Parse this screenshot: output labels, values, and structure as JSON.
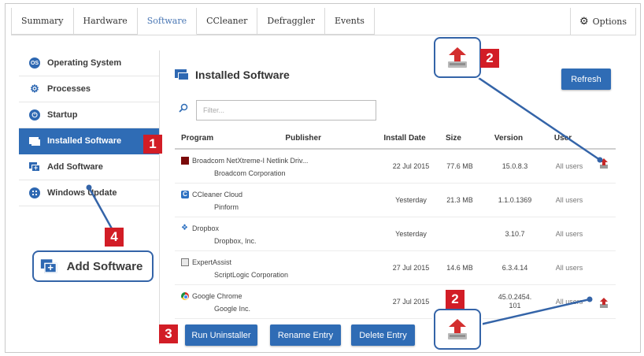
{
  "tabs": [
    "Summary",
    "Hardware",
    "Software",
    "CCleaner",
    "Defraggler",
    "Events"
  ],
  "active_tab": "Software",
  "options_label": "Options",
  "sidebar": {
    "items": [
      {
        "label": "Operating System",
        "icon": "os-icon"
      },
      {
        "label": "Processes",
        "icon": "processes-icon"
      },
      {
        "label": "Startup",
        "icon": "power-icon"
      },
      {
        "label": "Installed Software",
        "icon": "window-icon",
        "active": true
      },
      {
        "label": "Add Software",
        "icon": "add-window-icon"
      },
      {
        "label": "Windows Update",
        "icon": "windows-icon"
      }
    ]
  },
  "main": {
    "title": "Installed Software",
    "refresh_label": "Refresh",
    "filter_placeholder": "Filter..."
  },
  "table": {
    "headers": {
      "program": "Program",
      "publisher": "Publisher",
      "install_date": "Install Date",
      "size": "Size",
      "version": "Version",
      "user": "User"
    },
    "rows": [
      {
        "name": "Broadcom NetXtreme-I Netlink Driv...",
        "publisher": "Broadcom Corporation",
        "date": "22 Jul 2015",
        "size": "77.6 MB",
        "version": "15.0.8.3",
        "user": "All users",
        "icon": "broadcom-icon"
      },
      {
        "name": "CCleaner Cloud",
        "publisher": "Pinform",
        "date": "Yesterday",
        "size": "21.3 MB",
        "version": "1.1.0.1369",
        "user": "All users",
        "icon": "ccleaner-icon"
      },
      {
        "name": "Dropbox",
        "publisher": "Dropbox, Inc.",
        "date": "Yesterday",
        "size": "",
        "version": "3.10.7",
        "user": "All users",
        "icon": "dropbox-icon"
      },
      {
        "name": "ExpertAssist",
        "publisher": "ScriptLogic Corporation",
        "date": "27 Jul 2015",
        "size": "14.6 MB",
        "version": "6.3.4.14",
        "user": "All users",
        "icon": "expertassist-icon"
      },
      {
        "name": "Google Chrome",
        "publisher": "Google Inc.",
        "date": "27 Jul 2015",
        "size": "",
        "version": "45.0.2454.101",
        "version_line1": "45.0.2454.",
        "version_line2": "101",
        "user": "All users",
        "icon": "chrome-icon"
      }
    ]
  },
  "buttons": {
    "run_uninstaller": "Run Uninstaller",
    "rename_entry": "Rename Entry",
    "delete_entry": "Delete Entry"
  },
  "callouts": {
    "badge1": "1",
    "badge2": "2",
    "badge3": "3",
    "badge4": "4",
    "zoom_add_label": "Add Software"
  },
  "colors": {
    "accent": "#2f6cb5",
    "callout_red": "#d21d26",
    "callout_line": "#3464a8"
  }
}
